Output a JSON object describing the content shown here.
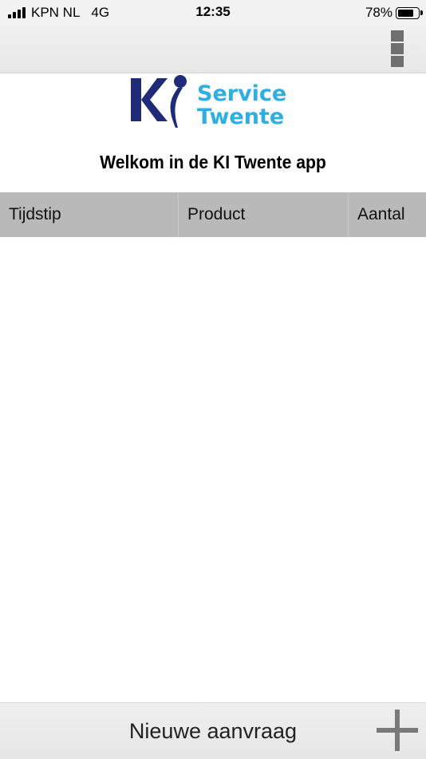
{
  "status_bar": {
    "carrier": "KPN NL",
    "network": "4G",
    "time": "12:35",
    "battery": "78%"
  },
  "logo": {
    "left_text": "KI",
    "right_text_line1": "Service",
    "right_text_line2": "Twente",
    "colors": {
      "navy": "#1f2a78",
      "cyan": "#2eaee3"
    }
  },
  "main": {
    "welcome": "Welkom in de KI Twente app"
  },
  "table": {
    "columns": [
      "Tijdstip",
      "Product",
      "Aantal"
    ],
    "rows": []
  },
  "footer": {
    "new_request_label": "Nieuwe aanvraag",
    "icon": "plus-icon"
  },
  "appbar": {
    "menu_icon": "menu-icon"
  }
}
